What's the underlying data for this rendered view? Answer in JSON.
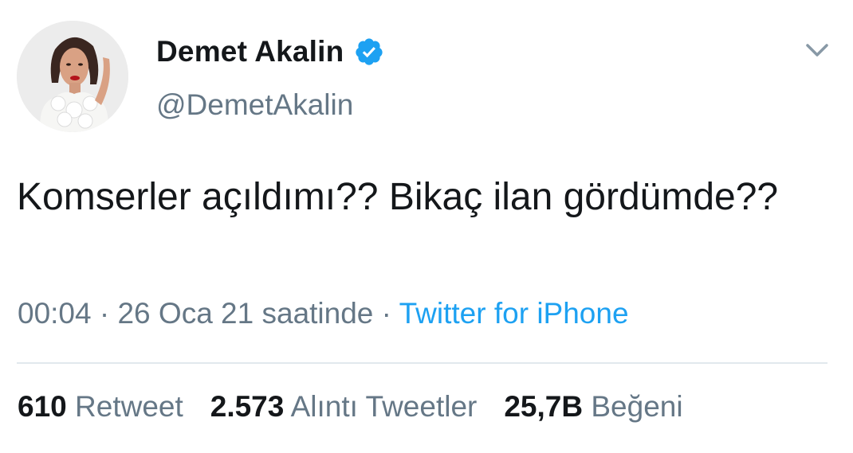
{
  "user": {
    "display_name": "Demet Akalin",
    "handle": "@DemetAkalin",
    "verified_icon": "verified-badge-icon"
  },
  "tweet": {
    "text": "Komserler açıldımı?? Bikaç ilan gördümde??",
    "time": "00:04",
    "separator": "·",
    "date": "26 Oca 21 saatinde",
    "source": "Twitter for iPhone"
  },
  "stats": [
    {
      "value": "610",
      "label": "Retweet"
    },
    {
      "value": "2.573",
      "label": "Alıntı Tweetler"
    },
    {
      "value": "25,7B",
      "label": "Beğeni"
    }
  ],
  "colors": {
    "text": "#14171a",
    "secondary": "#657786",
    "link": "#1da1f2",
    "verified": "#1da1f2",
    "divider": "#e1e8ed"
  }
}
